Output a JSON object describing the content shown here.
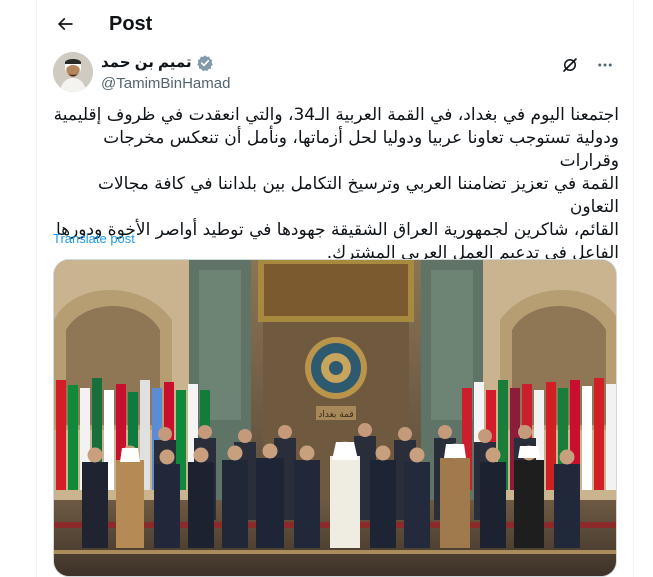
{
  "header": {
    "title": "Post",
    "back_icon": "arrow-left-icon"
  },
  "author": {
    "display_name": "تميم بن حمد",
    "handle": "@TamimBinHamad",
    "verified_icon": "verified-badge-icon",
    "verified_color": "#829aab"
  },
  "post": {
    "lines": [
      "اجتمعنا اليوم في بغداد، في القمة العربية الـ34، والتي انعقدت في ظروف إقليمية",
      "ودولية تستوجب تعاونا عربيا ودوليا لحل أزماتها، ونأمل أن تنعكس مخرجات وقرارات",
      "القمة في تعزيز تضامننا العربي وترسيخ التكامل بين بلداننا في كافة مجالات التعاون",
      "القائم، شاكرين لجمهورية العراق الشقيقة جهودها في توطيد أواصر الأخوة ودورها",
      "الفاعل في تدعيم العمل العربي المشترك."
    ],
    "translate_label": "Translate post",
    "banner_text": "قمة بغداد"
  },
  "colors": {
    "link": "#1d9bf0",
    "secondary_text": "#536471",
    "border": "#cfd9de"
  },
  "icons": {
    "grok": "grok-icon",
    "more": "more-icon"
  }
}
